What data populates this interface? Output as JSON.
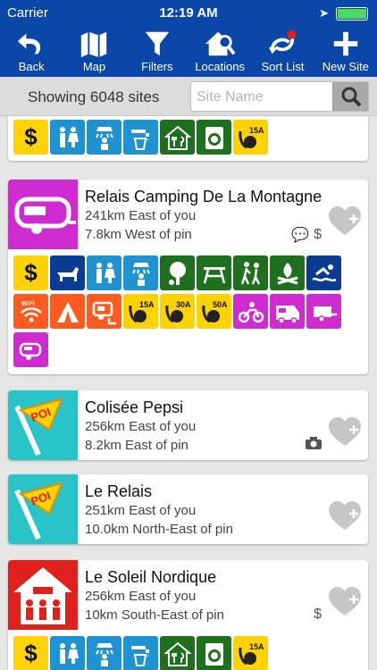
{
  "status_bar": {
    "carrier": "Carrier",
    "time": "12:19 AM"
  },
  "toolbar": [
    {
      "label": "Back",
      "icon": "back-arrow-icon"
    },
    {
      "label": "Map",
      "icon": "map-icon"
    },
    {
      "label": "Filters",
      "icon": "filter-funnel-icon"
    },
    {
      "label": "Locations",
      "icon": "house-search-icon"
    },
    {
      "label": "Sort List",
      "icon": "sort-pin-icon"
    },
    {
      "label": "New Site",
      "icon": "plus-icon"
    }
  ],
  "search": {
    "count_label": "Showing 6048 sites",
    "placeholder": "Site Name"
  },
  "sites": [
    {
      "name": "Relais Camping De La Montagne",
      "distance": "241km East of you",
      "pin_distance": "7.8km West of pin",
      "price": "$",
      "type": "campground"
    },
    {
      "name": "Colisée Pepsi",
      "distance": "256km East of you",
      "pin_distance": "8.2km East of pin",
      "type": "poi"
    },
    {
      "name": "Le Relais",
      "distance": "251km East of you",
      "pin_distance": "10.0km North-East of pin",
      "type": "poi"
    },
    {
      "name": "Le Soleil Nordique",
      "distance": "256km East of you",
      "pin_distance": "10km South-East of pin",
      "price": "$",
      "type": "hostel"
    }
  ],
  "amenity_labels": {
    "amp15": "15A",
    "amp30": "30A",
    "amp50": "50A",
    "wifi": "WiFi",
    "dollar": "$"
  },
  "colors": {
    "toolbar": "#0b47a8",
    "yellow": "#ffd200",
    "blue": "#1f93d1",
    "green": "#1e6f1e",
    "orange": "#ff5a1f",
    "magenta": "#d02ad3",
    "teal": "#29c4c8",
    "red": "#e0201b"
  }
}
